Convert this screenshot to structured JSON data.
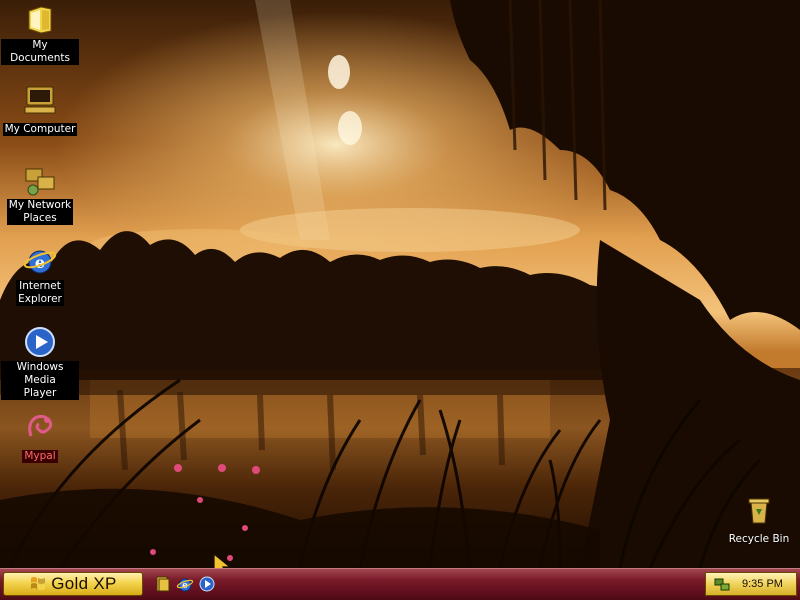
{
  "desktop": {
    "icons": [
      {
        "label": "My Documents",
        "icon": "my-documents-icon"
      },
      {
        "label": "My Computer",
        "icon": "my-computer-icon"
      },
      {
        "label": "My Network\nPlaces",
        "icon": "network-places-icon"
      },
      {
        "label": "Internet\nExplorer",
        "icon": "internet-explorer-icon"
      },
      {
        "label": "Windows Media\nPlayer",
        "icon": "media-player-icon"
      },
      {
        "label": "Mypal",
        "icon": "mypal-icon"
      },
      {
        "label": "Recycle Bin",
        "icon": "recycle-bin-icon"
      }
    ]
  },
  "taskbar": {
    "start_label": "Gold XP",
    "quick_launch": [
      "show-desktop-icon",
      "internet-explorer-icon",
      "media-player-icon"
    ],
    "clock": "9:35 PM"
  },
  "theme": {
    "taskbar_color": "#6a1220",
    "start_color": "#f0cf4a",
    "wallpaper_tone": "#b8651c"
  }
}
